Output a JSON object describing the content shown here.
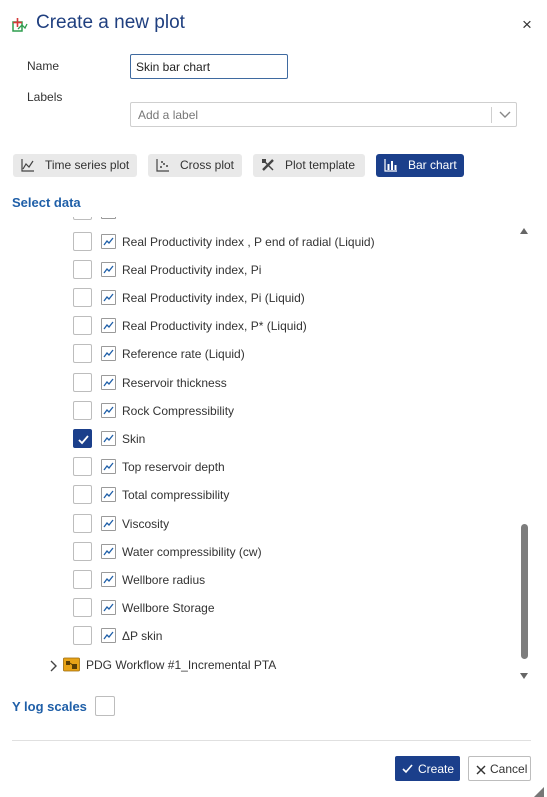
{
  "dialog": {
    "title": "Create a new plot",
    "close_glyph": "×"
  },
  "form": {
    "name_label": "Name",
    "name_value": "Skin bar chart",
    "labels_label": "Labels",
    "labels_placeholder": "Add a label"
  },
  "tabs": [
    {
      "label": "Time series plot",
      "icon": "time-series-icon",
      "active": false
    },
    {
      "label": "Cross plot",
      "icon": "cross-plot-icon",
      "active": false
    },
    {
      "label": "Plot template",
      "icon": "plot-template-icon",
      "active": false
    },
    {
      "label": "Bar chart",
      "icon": "bar-chart-icon",
      "active": true
    }
  ],
  "select_data": {
    "title": "Select data",
    "items": [
      {
        "label": "Real Productivity index , P end of radial (Liquid)",
        "checked": false
      },
      {
        "label": "Real Productivity index, Pi",
        "checked": false
      },
      {
        "label": "Real Productivity index, Pi (Liquid)",
        "checked": false
      },
      {
        "label": "Real Productivity index, P* (Liquid)",
        "checked": false
      },
      {
        "label": "Reference rate (Liquid)",
        "checked": false
      },
      {
        "label": "Reservoir thickness",
        "checked": false
      },
      {
        "label": "Rock Compressibility",
        "checked": false
      },
      {
        "label": "Skin",
        "checked": true
      },
      {
        "label": "Top reservoir depth",
        "checked": false
      },
      {
        "label": "Total compressibility",
        "checked": false
      },
      {
        "label": "Viscosity",
        "checked": false
      },
      {
        "label": "Water compressibility (cw)",
        "checked": false
      },
      {
        "label": "Wellbore radius",
        "checked": false
      },
      {
        "label": "Wellbore Storage",
        "checked": false
      },
      {
        "label": "ΔP skin",
        "checked": false
      }
    ],
    "tree_node": "PDG Workflow #1_Incremental PTA"
  },
  "y_log": {
    "label": "Y log scales",
    "checked": false
  },
  "footer": {
    "create_label": "Create",
    "cancel_label": "Cancel"
  },
  "colors": {
    "accent": "#1b3f8b",
    "title": "#1f3f7f",
    "section": "#1f5fa8"
  }
}
